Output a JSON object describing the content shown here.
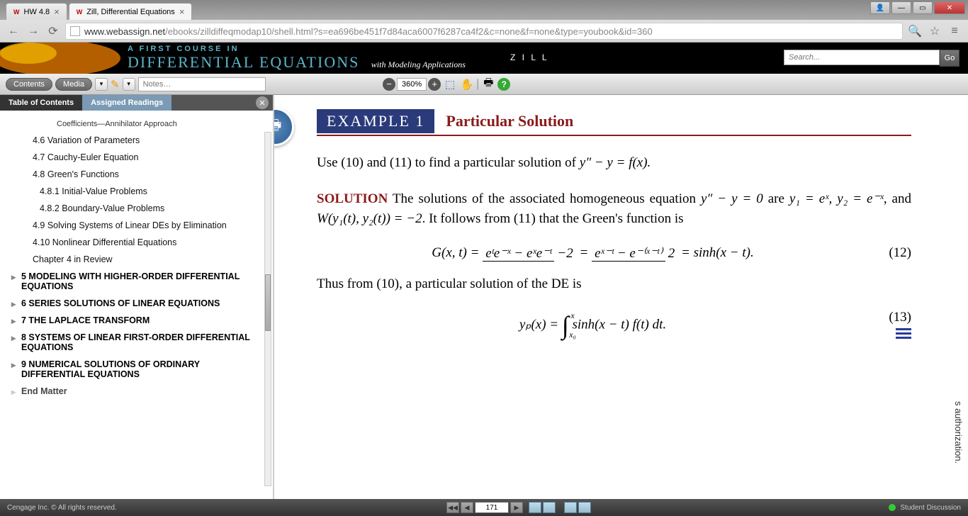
{
  "browser": {
    "tabs": [
      {
        "title": "HW 4.8",
        "active": false
      },
      {
        "title": "Zill, Differential Equations",
        "active": true
      }
    ],
    "url_host": "www.webassign.net",
    "url_path": "/ebooks/zilldiffeqmodap10/shell.html?s=ea696be451f7d84aca6007f6287ca4f2&c=none&f=none&type=youbook&id=360"
  },
  "book": {
    "pretitle": "A FIRST COURSE IN",
    "title": "DIFFERENTIAL EQUATIONS",
    "subtitle": "with Modeling Applications",
    "author": "Z I L L",
    "search_placeholder": "Search...",
    "go": "Go"
  },
  "toolbar": {
    "contents": "Contents",
    "media": "Media",
    "notes_placeholder": "Notes…",
    "zoom": "360%"
  },
  "sidebar": {
    "tab_toc": "Table of Contents",
    "tab_assigned": "Assigned Readings",
    "items": [
      {
        "label": "Coefficients—Annihilator Approach",
        "cls": "cut"
      },
      {
        "label": "4.6  Variation of Parameters",
        "cls": ""
      },
      {
        "label": "4.7  Cauchy-Euler Equation",
        "cls": ""
      },
      {
        "label": "4.8  Green's Functions",
        "cls": ""
      },
      {
        "label": "4.8.1  Initial-Value Problems",
        "cls": "sub"
      },
      {
        "label": "4.8.2  Boundary-Value Problems",
        "cls": "sub"
      },
      {
        "label": "4.9  Solving Systems of Linear DEs by Elimination",
        "cls": ""
      },
      {
        "label": "4.10  Nonlinear Differential Equations",
        "cls": ""
      },
      {
        "label": "Chapter 4 in Review",
        "cls": ""
      }
    ],
    "chapters": [
      "5 MODELING WITH HIGHER-ORDER DIFFERENTIAL EQUATIONS",
      "6 SERIES SOLUTIONS OF LINEAR EQUATIONS",
      "7 THE LAPLACE TRANSFORM",
      "8 SYSTEMS OF LINEAR FIRST-ORDER DIFFERENTIAL EQUATIONS",
      "9 NUMERICAL SOLUTIONS OF ORDINARY DIFFERENTIAL EQUATIONS"
    ],
    "end": "End Matter"
  },
  "content": {
    "example_badge": "EXAMPLE 1",
    "example_title": "Particular Solution",
    "p1_a": "Use (10) and (11) to find a particular solution of ",
    "p1_eq": "y″ − y = f(x).",
    "solution_label": "SOLUTION",
    "p2_a": "   The solutions of the associated homogeneous equation ",
    "p2_eq1": "y″ − y = 0",
    "p2_b": " are ",
    "p2_eq2": "y₁ = eˣ, y₂ = e⁻ˣ",
    "p2_c": ", and ",
    "p2_eq3": "W(y₁(t), y₂(t)) = −2",
    "p2_d": ". It follows from (11) that the Green's function is",
    "eq12_lhs": "G(x, t) = ",
    "eq12_frac1_n": "eᵗe⁻ˣ − eˣe⁻ᵗ",
    "eq12_frac1_d": "−2",
    "eq12_mid": " = ",
    "eq12_frac2_n": "eˣ⁻ᵗ − e⁻⁽ˣ⁻ᵗ⁾",
    "eq12_frac2_d": "2",
    "eq12_rhs": " = sinh(x − t).",
    "eq12_num": "(12)",
    "p3": "Thus from (10), a particular solution of the DE is",
    "eq13_lhs": "yₚ(x) = ",
    "eq13_int_up": "x",
    "eq13_int_lo": "x₀",
    "eq13_body": " sinh(x − t) f(t) dt.",
    "eq13_num": "(13)",
    "side_text": "s authorization."
  },
  "footer": {
    "copyright": "Cengage Inc.  © All rights reserved.",
    "page": "171",
    "discussion": "Student Discussion"
  }
}
